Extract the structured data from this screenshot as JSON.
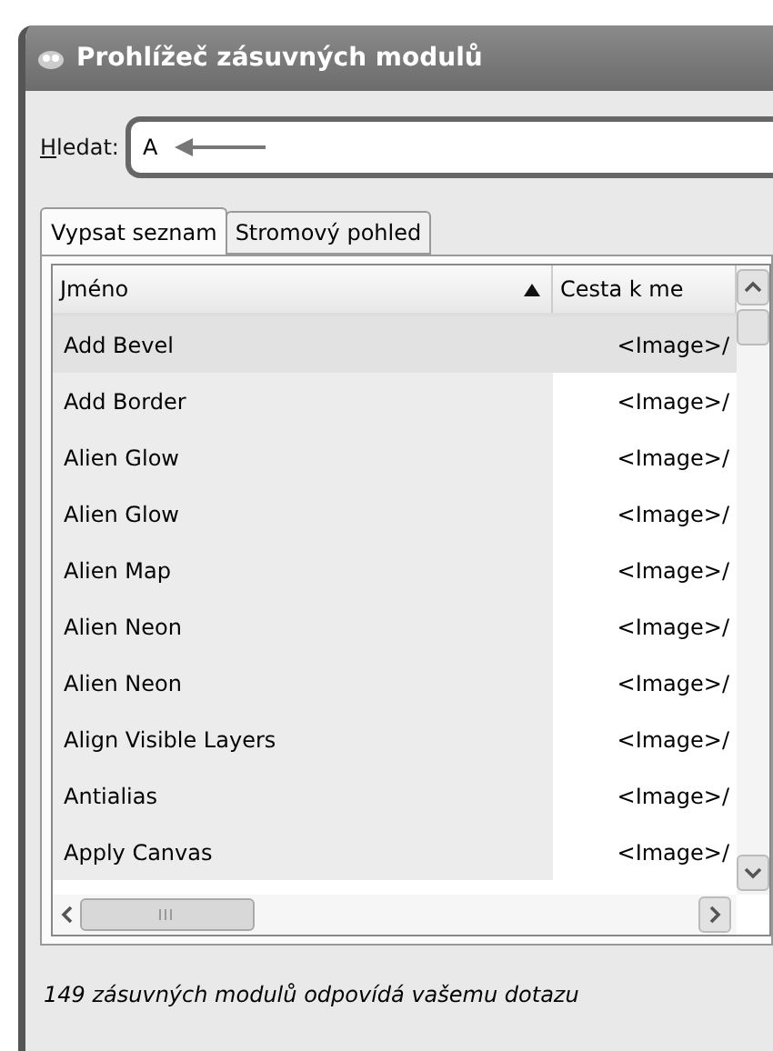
{
  "window": {
    "title": "Prohlížeč zásuvných modulů"
  },
  "search": {
    "label": "Hledat:",
    "value": "A"
  },
  "tabs": [
    {
      "label": "Vypsat seznam",
      "selected": true
    },
    {
      "label": "Stromový pohled",
      "selected": false
    }
  ],
  "table": {
    "columns": [
      {
        "label": "Jméno",
        "sorted": true
      },
      {
        "label": "Cesta k me",
        "sorted": false
      }
    ],
    "rows": [
      {
        "name": "Add Bevel",
        "path": "<Image>/",
        "selected": true
      },
      {
        "name": "Add Border",
        "path": "<Image>/",
        "selected": false
      },
      {
        "name": "Alien Glow",
        "path": "<Image>/",
        "selected": false
      },
      {
        "name": "Alien Glow",
        "path": "<Image>/",
        "selected": false
      },
      {
        "name": "Alien Map",
        "path": "<Image>/",
        "selected": false
      },
      {
        "name": "Alien Neon",
        "path": "<Image>/",
        "selected": false
      },
      {
        "name": "Alien Neon",
        "path": "<Image>/",
        "selected": false
      },
      {
        "name": "Align Visible Layers",
        "path": "<Image>/",
        "selected": false
      },
      {
        "name": "Antialias",
        "path": "<Image>/",
        "selected": false
      },
      {
        "name": "Apply Canvas",
        "path": "<Image>/",
        "selected": false
      }
    ]
  },
  "status_bar": "149 zásuvných modulů odpovídá vašemu dotazu"
}
